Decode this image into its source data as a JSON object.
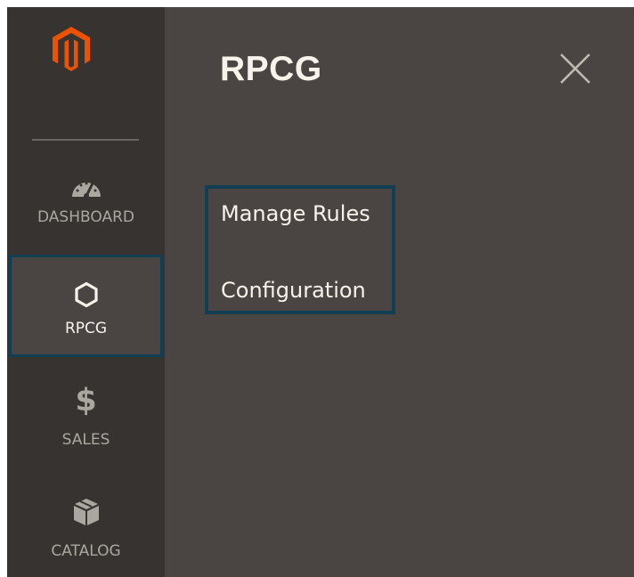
{
  "sidebar": {
    "logo_icon": "magento-logo",
    "items": [
      {
        "icon": "dashboard-icon",
        "label": "DASHBOARD"
      },
      {
        "icon": "hexagon-icon",
        "label": "RPCG",
        "active": true
      },
      {
        "icon": "dollar-icon",
        "label": "SALES",
        "glyph": "$"
      },
      {
        "icon": "box-icon",
        "label": "CATALOG"
      }
    ]
  },
  "panel": {
    "title": "RPCG",
    "close_icon": "close-icon",
    "links": [
      {
        "label": "Manage Rules"
      },
      {
        "label": "Configuration"
      }
    ]
  },
  "colors": {
    "sidebar_bg": "#373330",
    "panel_bg": "#4a4542",
    "logo_orange": "#eb5202",
    "highlight_border": "#113e52",
    "text_light": "#f7f3eb",
    "text_muted": "#aaa6a0"
  }
}
